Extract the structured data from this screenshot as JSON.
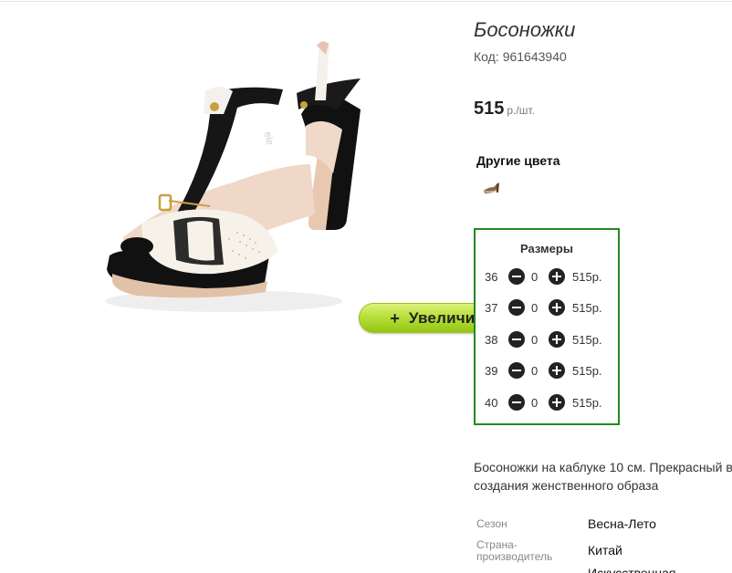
{
  "product": {
    "title": "Босоножки",
    "code_label": "Код:",
    "code_value": "961643940",
    "price_value": "515",
    "price_unit": "р./шт.",
    "image_alt": "sandal-product-photo",
    "zoom_button": {
      "icon": "+",
      "label": "Увеличить"
    }
  },
  "other_colors": {
    "heading": "Другие цвета",
    "swatch_icon": "sandal-thumbnail-icon"
  },
  "sizes": {
    "heading": "Размеры",
    "rows": [
      {
        "size": "36",
        "qty": "0",
        "price": "515р."
      },
      {
        "size": "37",
        "qty": "0",
        "price": "515р."
      },
      {
        "size": "38",
        "qty": "0",
        "price": "515р."
      },
      {
        "size": "39",
        "qty": "0",
        "price": "515р."
      },
      {
        "size": "40",
        "qty": "0",
        "price": "515р."
      }
    ]
  },
  "description": {
    "line1": "Босоножки на каблуке 10 см. Прекрасный в",
    "line2": "создания женственного образа"
  },
  "specs": [
    {
      "label_line1": "Сезон",
      "label_line2": "",
      "value": "Весна-Лето"
    },
    {
      "label_line1": "Страна-",
      "label_line2": "производитель",
      "value": "Китай"
    },
    {
      "label_line1": "",
      "label_line2": "",
      "value": "Искусственная"
    }
  ],
  "colors": {
    "sizes_border": "#1f8a1f",
    "zoom_button": "#b7e03a"
  }
}
